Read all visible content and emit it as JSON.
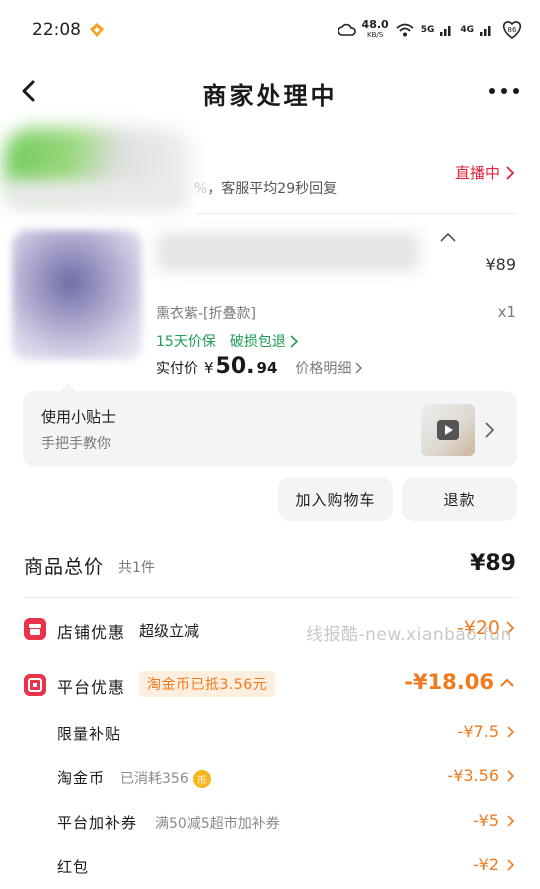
{
  "status_bar": {
    "time": "22:08",
    "net_speed": "48.0",
    "net_unit": "KB/S",
    "signal_1": "5G",
    "signal_2": "4G"
  },
  "nav": {
    "title": "商家处理中"
  },
  "shop": {
    "subtitle_faint": "%",
    "subtitle": "，客服平均29秒回复",
    "live_label": "直播中"
  },
  "product": {
    "price": "¥89",
    "variant": "熏衣紫-[折叠款]",
    "quantity": "x1",
    "guarantee_1": "15天价保",
    "guarantee_2": "破损包退",
    "paid_label": "实付价",
    "paid_currency": "¥",
    "paid_int": "50.",
    "paid_dec": "94",
    "price_detail": "价格明细"
  },
  "tips": {
    "title": "使用小贴士",
    "subtitle": "手把手教你"
  },
  "actions": {
    "add_cart": "加入购物车",
    "refund": "退款"
  },
  "summary": {
    "total_label": "商品总价",
    "total_count": "共1件",
    "total_price": "¥89",
    "shop_discount_label": "店铺优惠",
    "shop_discount_sub": "超级立减",
    "shop_discount_amount": "-¥20",
    "platform_discount_label": "平台优惠",
    "platform_badge": "淘金币已抵3.56元",
    "platform_discount_amount": "-¥18.06",
    "items": [
      {
        "label": "限量补贴",
        "note": "",
        "amount": "-¥7.5"
      },
      {
        "label": "淘金币",
        "note": "已消耗356",
        "amount": "-¥3.56"
      },
      {
        "label": "平台加补券",
        "note": "满50减5超市加补券",
        "amount": "-¥5"
      },
      {
        "label": "红包",
        "note": "",
        "amount": "-¥2"
      }
    ]
  },
  "watermark": "线报酷-new.xianbao.fun",
  "colors": {
    "accent_orange": "#f07a1e",
    "live_red": "#e0243a",
    "guarantee_green": "#1f9d55",
    "discount_icon_red": "#e8334a"
  }
}
